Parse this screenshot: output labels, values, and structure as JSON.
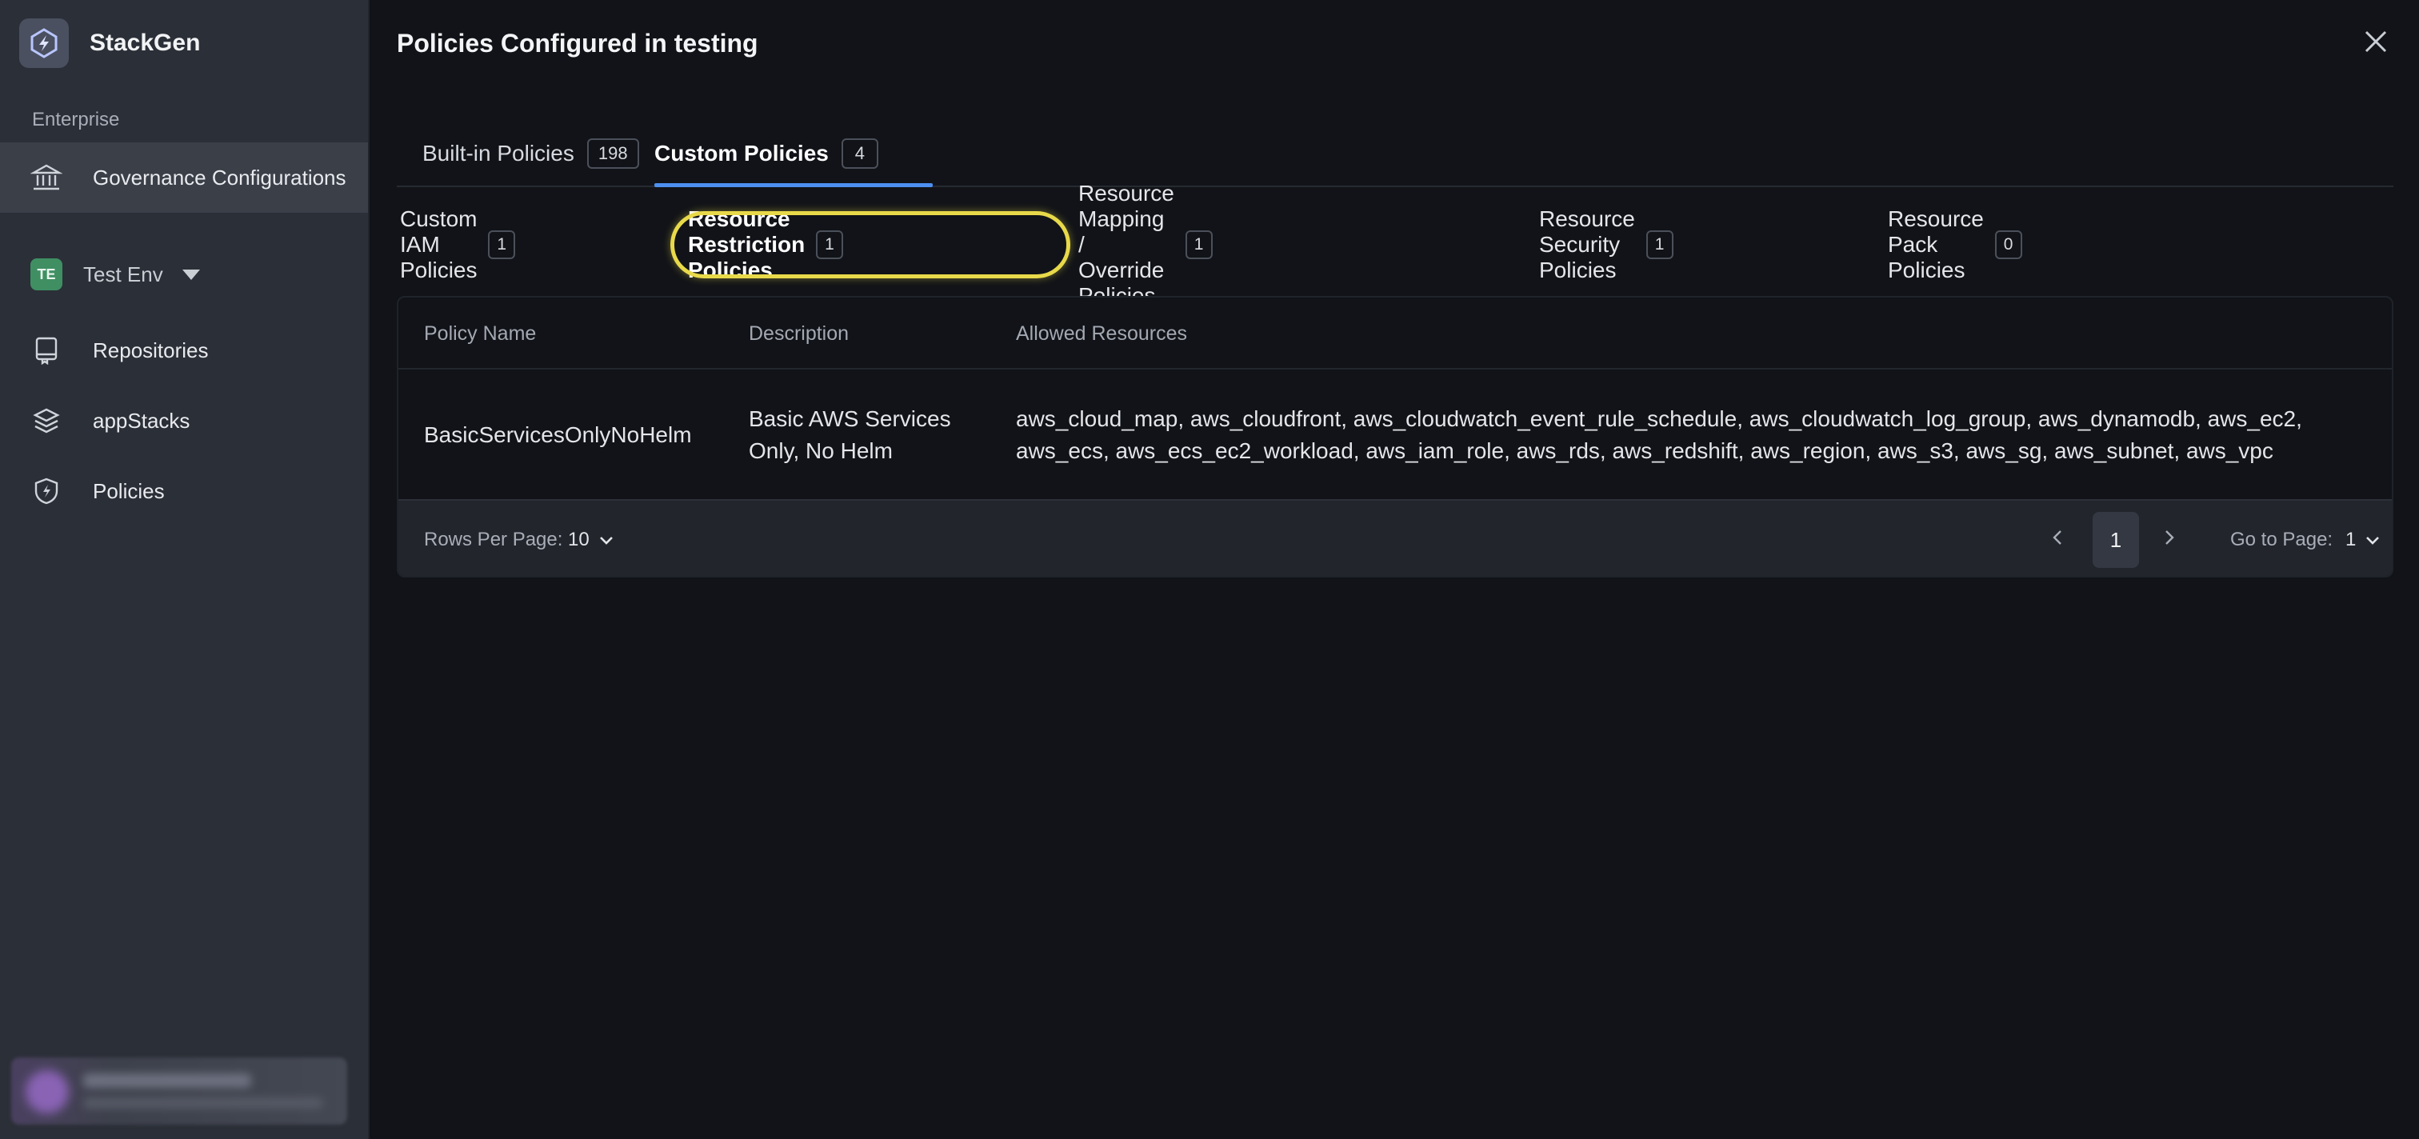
{
  "sidebar": {
    "brand_name": "StackGen",
    "section_label": "Enterprise",
    "active_item": {
      "label": "Governance Configurations",
      "icon": "bank-icon"
    },
    "environment": {
      "badge": "TE",
      "name": "Test Env",
      "badge_color": "#3f8f63"
    },
    "items": [
      {
        "label": "Repositories",
        "icon": "repository-icon"
      },
      {
        "label": "appStacks",
        "icon": "layers-icon"
      },
      {
        "label": "Policies",
        "icon": "shield-bolt-icon"
      }
    ]
  },
  "panel": {
    "title": "Policies Configured in testing",
    "tabs": [
      {
        "label": "Built-in Policies",
        "count": "198"
      },
      {
        "label": "Custom Policies",
        "count": "4"
      }
    ],
    "active_tab": "Custom Policies",
    "subtabs": [
      {
        "label": "Custom IAM Policies",
        "count": "1"
      },
      {
        "label": "Resource Restriction Policies",
        "count": "1"
      },
      {
        "label": "Resource Mapping / Override Policies",
        "count": "1"
      },
      {
        "label": "Resource Security Policies",
        "count": "1"
      },
      {
        "label": "Resource Pack Policies",
        "count": "0"
      }
    ],
    "active_subtab": "Resource Restriction Policies",
    "table": {
      "columns": [
        "Policy Name",
        "Description",
        "Allowed Resources"
      ],
      "rows": [
        {
          "policy_name": "BasicServicesOnlyNoHelm",
          "description_line1": "Basic AWS Services",
          "description_line2": "Only, No Helm",
          "resources_line1": "aws_cloud_map, aws_cloudfront, aws_cloudwatch_event_rule_schedule, aws_cloudwatch_log_group, aws_dynamodb, aws_ec2,",
          "resources_line2": "aws_ecs, aws_ecs_ec2_workload, aws_iam_role, aws_rds, aws_redshift, aws_region, aws_s3, aws_sg, aws_subnet, aws_vpc"
        }
      ]
    },
    "pagination": {
      "rows_per_page_label": "Rows Per Page:",
      "rows_per_page": "10",
      "current_page": "1",
      "go_to_label": "Go to Page:",
      "go_to_value": "1"
    }
  },
  "colors": {
    "accent": "#4d8ff0",
    "highlight": "#e8d94a"
  }
}
